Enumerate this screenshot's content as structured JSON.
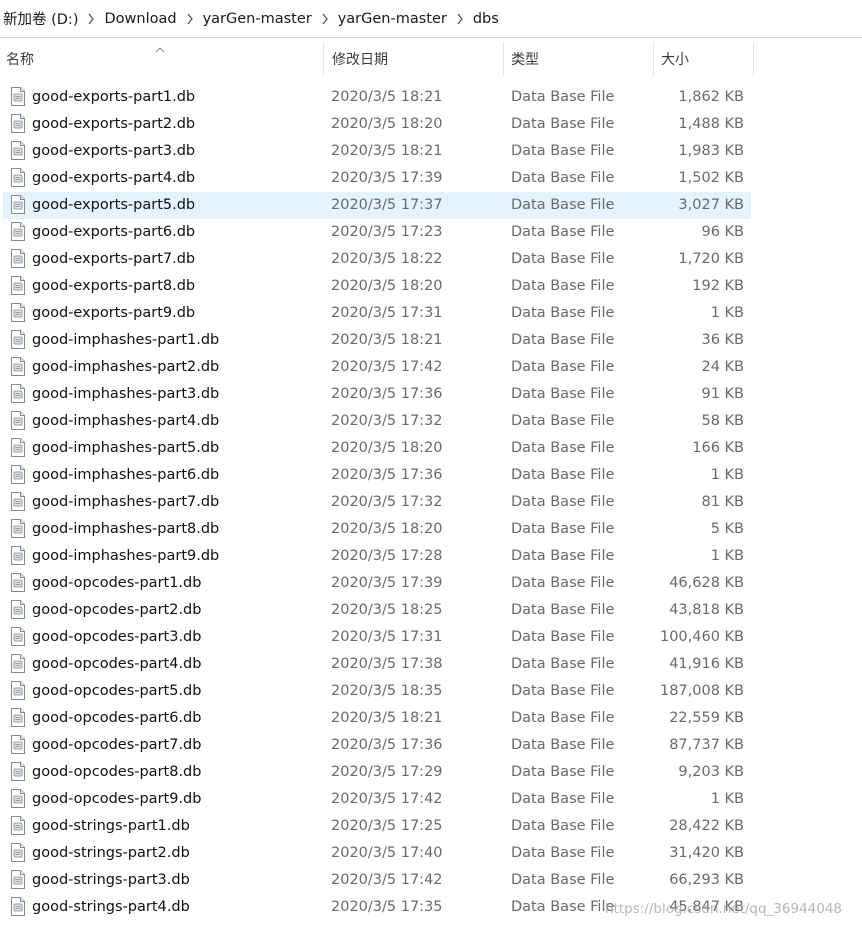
{
  "breadcrumb": [
    "新加卷 (D:)",
    "Download",
    "yarGen-master",
    "yarGen-master",
    "dbs"
  ],
  "columns": {
    "name": "名称",
    "date": "修改日期",
    "type": "类型",
    "size": "大小"
  },
  "selected_index": 4,
  "colors": {
    "selected_row": "#e5f3ff",
    "secondary_text": "#6a6a6a"
  },
  "files": [
    {
      "name": "good-exports-part1.db",
      "date": "2020/3/5 18:21",
      "type": "Data Base File",
      "size": "1,862 KB"
    },
    {
      "name": "good-exports-part2.db",
      "date": "2020/3/5 18:20",
      "type": "Data Base File",
      "size": "1,488 KB"
    },
    {
      "name": "good-exports-part3.db",
      "date": "2020/3/5 18:21",
      "type": "Data Base File",
      "size": "1,983 KB"
    },
    {
      "name": "good-exports-part4.db",
      "date": "2020/3/5 17:39",
      "type": "Data Base File",
      "size": "1,502 KB"
    },
    {
      "name": "good-exports-part5.db",
      "date": "2020/3/5 17:37",
      "type": "Data Base File",
      "size": "3,027 KB"
    },
    {
      "name": "good-exports-part6.db",
      "date": "2020/3/5 17:23",
      "type": "Data Base File",
      "size": "96 KB"
    },
    {
      "name": "good-exports-part7.db",
      "date": "2020/3/5 18:22",
      "type": "Data Base File",
      "size": "1,720 KB"
    },
    {
      "name": "good-exports-part8.db",
      "date": "2020/3/5 18:20",
      "type": "Data Base File",
      "size": "192 KB"
    },
    {
      "name": "good-exports-part9.db",
      "date": "2020/3/5 17:31",
      "type": "Data Base File",
      "size": "1 KB"
    },
    {
      "name": "good-imphashes-part1.db",
      "date": "2020/3/5 18:21",
      "type": "Data Base File",
      "size": "36 KB"
    },
    {
      "name": "good-imphashes-part2.db",
      "date": "2020/3/5 17:42",
      "type": "Data Base File",
      "size": "24 KB"
    },
    {
      "name": "good-imphashes-part3.db",
      "date": "2020/3/5 17:36",
      "type": "Data Base File",
      "size": "91 KB"
    },
    {
      "name": "good-imphashes-part4.db",
      "date": "2020/3/5 17:32",
      "type": "Data Base File",
      "size": "58 KB"
    },
    {
      "name": "good-imphashes-part5.db",
      "date": "2020/3/5 18:20",
      "type": "Data Base File",
      "size": "166 KB"
    },
    {
      "name": "good-imphashes-part6.db",
      "date": "2020/3/5 17:36",
      "type": "Data Base File",
      "size": "1 KB"
    },
    {
      "name": "good-imphashes-part7.db",
      "date": "2020/3/5 17:32",
      "type": "Data Base File",
      "size": "81 KB"
    },
    {
      "name": "good-imphashes-part8.db",
      "date": "2020/3/5 18:20",
      "type": "Data Base File",
      "size": "5 KB"
    },
    {
      "name": "good-imphashes-part9.db",
      "date": "2020/3/5 17:28",
      "type": "Data Base File",
      "size": "1 KB"
    },
    {
      "name": "good-opcodes-part1.db",
      "date": "2020/3/5 17:39",
      "type": "Data Base File",
      "size": "46,628 KB"
    },
    {
      "name": "good-opcodes-part2.db",
      "date": "2020/3/5 18:25",
      "type": "Data Base File",
      "size": "43,818 KB"
    },
    {
      "name": "good-opcodes-part3.db",
      "date": "2020/3/5 17:31",
      "type": "Data Base File",
      "size": "100,460 KB"
    },
    {
      "name": "good-opcodes-part4.db",
      "date": "2020/3/5 17:38",
      "type": "Data Base File",
      "size": "41,916 KB"
    },
    {
      "name": "good-opcodes-part5.db",
      "date": "2020/3/5 18:35",
      "type": "Data Base File",
      "size": "187,008 KB"
    },
    {
      "name": "good-opcodes-part6.db",
      "date": "2020/3/5 18:21",
      "type": "Data Base File",
      "size": "22,559 KB"
    },
    {
      "name": "good-opcodes-part7.db",
      "date": "2020/3/5 17:36",
      "type": "Data Base File",
      "size": "87,737 KB"
    },
    {
      "name": "good-opcodes-part8.db",
      "date": "2020/3/5 17:29",
      "type": "Data Base File",
      "size": "9,203 KB"
    },
    {
      "name": "good-opcodes-part9.db",
      "date": "2020/3/5 17:42",
      "type": "Data Base File",
      "size": "1 KB"
    },
    {
      "name": "good-strings-part1.db",
      "date": "2020/3/5 17:25",
      "type": "Data Base File",
      "size": "28,422 KB"
    },
    {
      "name": "good-strings-part2.db",
      "date": "2020/3/5 17:40",
      "type": "Data Base File",
      "size": "31,420 KB"
    },
    {
      "name": "good-strings-part3.db",
      "date": "2020/3/5 17:42",
      "type": "Data Base File",
      "size": "66,293 KB"
    },
    {
      "name": "good-strings-part4.db",
      "date": "2020/3/5 17:35",
      "type": "Data Base File",
      "size": "45,847 KB"
    }
  ],
  "watermark": "https://blog.csdn.net/qq_36944048",
  "icons": {
    "file": "database-file-icon",
    "separator": "chevron-right-icon",
    "sort": "sort-ascending-icon"
  }
}
